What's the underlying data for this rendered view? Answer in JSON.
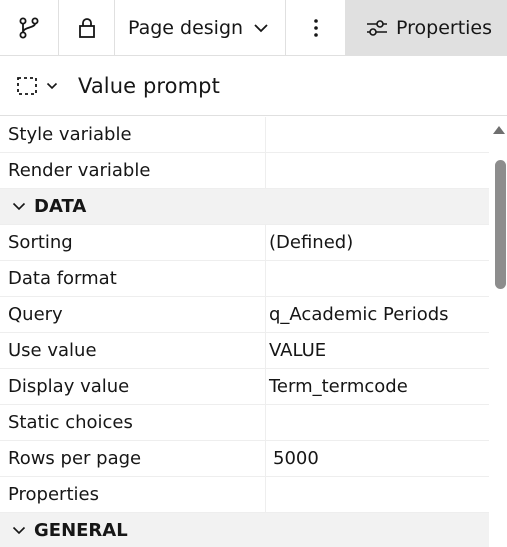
{
  "toolbar": {
    "branch_icon": "branch-icon",
    "lock_icon": "lock-icon",
    "page_design_label": "Page design",
    "more_icon": "overflow-menu-icon",
    "properties_label": "Properties"
  },
  "header": {
    "select_icon": "marquee-select-icon",
    "title": "Value prompt"
  },
  "properties": {
    "rows_top": [
      {
        "name": "Style variable",
        "value": ""
      },
      {
        "name": "Render variable",
        "value": ""
      }
    ],
    "data_section": "DATA",
    "data_rows": [
      {
        "name": "Sorting",
        "value": "(Defined)"
      },
      {
        "name": "Data format",
        "value": ""
      },
      {
        "name": "Query",
        "value": "q_Academic Periods"
      },
      {
        "name": "Use value",
        "value": "VALUE"
      },
      {
        "name": "Display value",
        "value": "Term_termcode"
      },
      {
        "name": "Static choices",
        "value": ""
      },
      {
        "name": "Rows per page",
        "value": "5000"
      },
      {
        "name": "Properties",
        "value": ""
      }
    ],
    "general_section": "GENERAL"
  }
}
